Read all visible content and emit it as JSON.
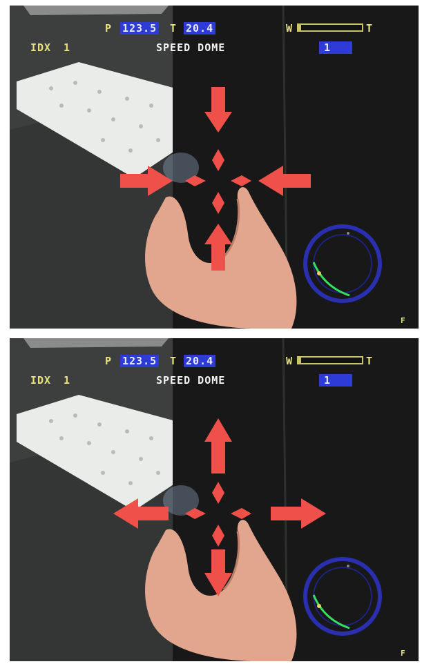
{
  "frames": [
    {
      "id": "frame-1",
      "pan_label": "P",
      "pan_value": "123.5",
      "tilt_label": "T",
      "tilt_value": "20.4",
      "idx_label": "IDX",
      "idx_value": "1",
      "camera_name": "SPEED DOME",
      "preset_value": "1",
      "zoom_wide_label": "W",
      "zoom_tele_label": "T",
      "zoom_level_fraction": 0.04,
      "corner_right": "F",
      "outer_arrows": {
        "up": "in",
        "down": "in",
        "left": "in",
        "right": "in"
      }
    },
    {
      "id": "frame-2",
      "pan_label": "P",
      "pan_value": "123.5",
      "tilt_label": "T",
      "tilt_value": "20.4",
      "idx_label": "IDX",
      "idx_value": "1",
      "camera_name": "SPEED DOME",
      "preset_value": "1",
      "zoom_wide_label": "W",
      "zoom_tele_label": "T",
      "zoom_level_fraction": 0.04,
      "corner_right": "F",
      "outer_arrows": {
        "up": "out",
        "down": "out",
        "left": "out",
        "right": "out"
      }
    }
  ],
  "colors": {
    "arrow": "#f0504a",
    "osd_yellow": "#e8e27a",
    "osd_highlight": "#2e3bd6",
    "compass_ring": "#2a2fb0",
    "compass_arc": "#35e060"
  },
  "icons": {
    "direction_pad": "ptz-direction-arrows-icon",
    "compass": "pan-tilt-compass-icon"
  }
}
